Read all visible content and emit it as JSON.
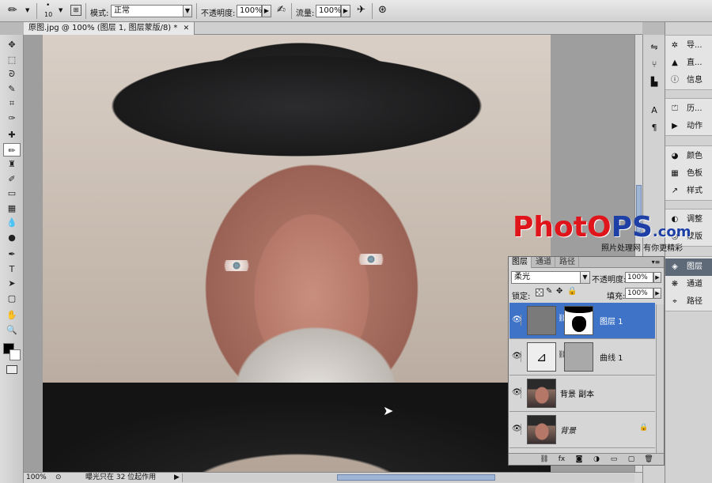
{
  "options_bar": {
    "brush_size": "10",
    "mode_label": "模式:",
    "mode_value": "正常",
    "opacity_label": "不透明度:",
    "opacity_value": "100%",
    "flow_label": "流量:",
    "flow_value": "100%"
  },
  "document": {
    "tab_title": "原图.jpg @ 100% (图层 1, 图层蒙版/8) *",
    "close_glyph": "✕"
  },
  "toolbox": {
    "tools": [
      "move-icon",
      "marquee-icon",
      "lasso-icon",
      "quick-select-icon",
      "crop-icon",
      "eyedropper-icon",
      "healing-icon",
      "brush-icon",
      "clone-stamp-icon",
      "history-brush-icon",
      "eraser-icon",
      "gradient-icon",
      "blur-icon",
      "dodge-icon",
      "pen-icon",
      "type-icon",
      "path-select-icon",
      "shape-icon",
      "hand-icon",
      "zoom-icon"
    ],
    "glyphs": [
      "✥",
      "⬚",
      "ᘐ",
      "✎",
      "⌗",
      "✑",
      "✚",
      "✏",
      "♜",
      "✐",
      "▭",
      "▦",
      "💧",
      "●",
      "✒",
      "T",
      "➤",
      "▢",
      "✋",
      "🔍"
    ],
    "foreground_color": "#000000",
    "background_color": "#ffffff"
  },
  "status_bar": {
    "zoom": "100%",
    "message": "曝光只在 32 位起作用"
  },
  "watermark": {
    "logo_red": "Phot",
    "logo_blue": "PS",
    "logo_suffix": ".com",
    "tagline": "照片处理网 有你更精彩",
    "o_letter": "O"
  },
  "dock_icons": [
    "navigator-icon",
    "histogram-icon",
    "info-icon",
    "character-icon",
    "paragraph-icon"
  ],
  "dock": {
    "groups": [
      {
        "items": [
          {
            "label": "导...",
            "icon": "navigator-icon",
            "glyph": "✲"
          },
          {
            "label": "直...",
            "icon": "histogram-icon",
            "glyph": "▲"
          },
          {
            "label": "信息",
            "icon": "info-icon",
            "glyph": "ⓘ"
          }
        ]
      },
      {
        "items": [
          {
            "label": "历...",
            "icon": "history-icon",
            "glyph": "⏍"
          },
          {
            "label": "动作",
            "icon": "actions-icon",
            "glyph": "▶"
          }
        ]
      },
      {
        "items": [
          {
            "label": "颜色",
            "icon": "color-icon",
            "glyph": "◕"
          },
          {
            "label": "色板",
            "icon": "swatches-icon",
            "glyph": "▦"
          },
          {
            "label": "样式",
            "icon": "styles-icon",
            "glyph": "↗"
          }
        ]
      },
      {
        "items": [
          {
            "label": "调整",
            "icon": "adjustments-icon",
            "glyph": "◐"
          },
          {
            "label": "蒙版",
            "icon": "masks-icon",
            "glyph": "◎"
          }
        ]
      },
      {
        "items": [
          {
            "label": "图层",
            "icon": "layers-icon",
            "glyph": "◈",
            "active": true
          },
          {
            "label": "通道",
            "icon": "channels-icon",
            "glyph": "❋"
          },
          {
            "label": "路径",
            "icon": "paths-icon",
            "glyph": "⌖"
          }
        ]
      }
    ]
  },
  "layers_panel": {
    "tabs": [
      "图层",
      "通道",
      "路径"
    ],
    "menu_glyph": "▾≡",
    "blend_mode": "柔光",
    "opacity_label": "不透明度:",
    "opacity_value": "100%",
    "lock_label": "锁定:",
    "fill_label": "填充:",
    "fill_value": "100%",
    "layers": [
      {
        "name": "图层 1",
        "selected": true
      },
      {
        "name": "曲线 1",
        "selected": false
      },
      {
        "name": "背景 副本",
        "selected": false
      },
      {
        "name": "背景",
        "selected": false,
        "locked": true
      }
    ],
    "bottom_icons": [
      "link-icon",
      "fx-icon",
      "mask-icon",
      "adjustment-icon",
      "group-icon",
      "new-layer-icon",
      "trash-icon"
    ],
    "bottom_glyphs": [
      "⛓",
      "fx",
      "◙",
      "◑",
      "▭",
      "▢",
      "🗑"
    ]
  }
}
